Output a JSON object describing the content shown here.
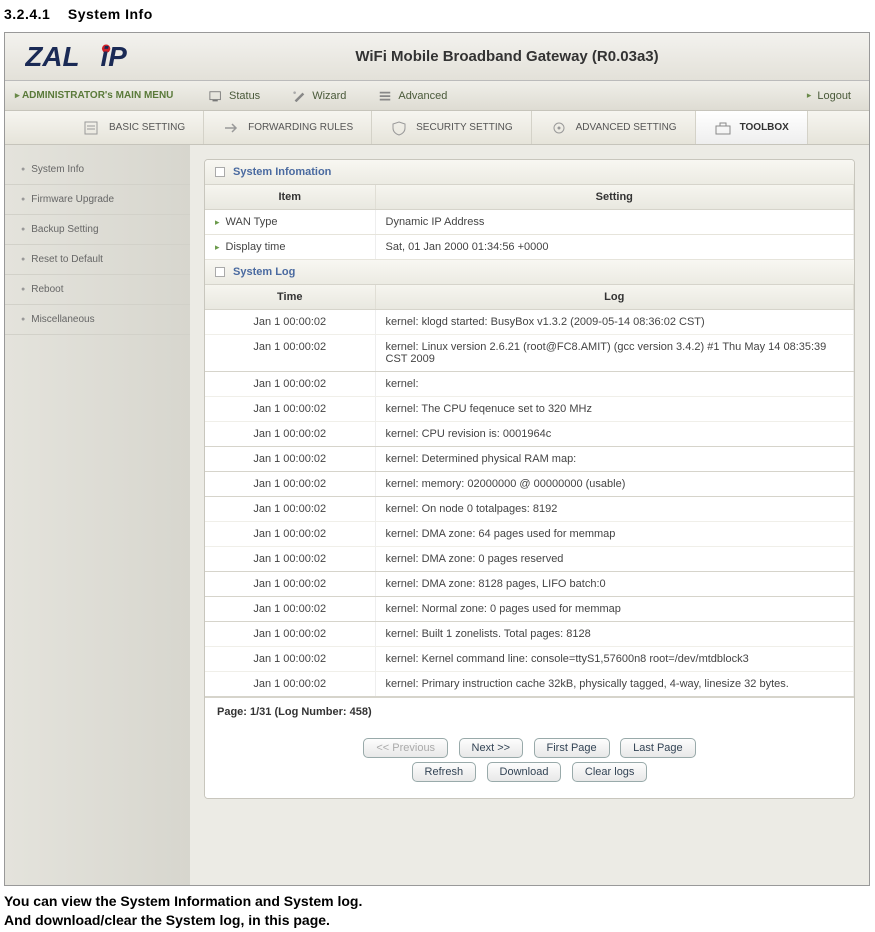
{
  "doc": {
    "section_number": "3.2.4.1",
    "section_title": "System Info",
    "footer_line1": "You can view the System Information and System log.",
    "footer_line2": "And download/clear the System log, in this page."
  },
  "header": {
    "product_title": "WiFi Mobile Broadband Gateway (R0.03a3)"
  },
  "topmenu": {
    "admin_label": "ADMINISTRATOR's MAIN MENU",
    "items": [
      {
        "label": "Status"
      },
      {
        "label": "Wizard"
      },
      {
        "label": "Advanced"
      }
    ],
    "logout": "Logout"
  },
  "submenu": {
    "items": [
      {
        "label": "BASIC  SETTING"
      },
      {
        "label": "FORWARDING RULES"
      },
      {
        "label": "SECURITY  SETTING"
      },
      {
        "label": "ADVANCED  SETTING"
      },
      {
        "label": "TOOLBOX"
      }
    ]
  },
  "sidebar": {
    "items": [
      {
        "label": "System Info"
      },
      {
        "label": "Firmware  Upgrade"
      },
      {
        "label": "Backup  Setting"
      },
      {
        "label": "Reset to Default"
      },
      {
        "label": "Reboot"
      },
      {
        "label": "Miscellaneous"
      }
    ]
  },
  "sys_info": {
    "title": "System Infomation",
    "col_item": "Item",
    "col_setting": "Setting",
    "rows": [
      {
        "item": "WAN Type",
        "value": "Dynamic IP Address"
      },
      {
        "item": "Display time",
        "value": "Sat, 01 Jan 2000 01:34:56 +0000"
      }
    ]
  },
  "sys_log": {
    "title": "System Log",
    "col_time": "Time",
    "col_log": "Log",
    "rows": [
      {
        "time": "Jan 1 00:00:02",
        "log": "kernel: klogd started: BusyBox v1.3.2 (2009-05-14 08:36:02 CST)"
      },
      {
        "time": "Jan 1 00:00:02",
        "log": "kernel: Linux version 2.6.21 (root@FC8.AMIT) (gcc version 3.4.2) #1 Thu May 14 08:35:39 CST 2009"
      },
      {
        "time": "Jan 1 00:00:02",
        "log": "kernel:"
      },
      {
        "time": "Jan 1 00:00:02",
        "log": "kernel: The CPU feqenuce set to 320 MHz"
      },
      {
        "time": "Jan 1 00:00:02",
        "log": "kernel: CPU revision is: 0001964c"
      },
      {
        "time": "Jan 1 00:00:02",
        "log": "kernel: Determined physical RAM map:"
      },
      {
        "time": "Jan 1 00:00:02",
        "log": "kernel: memory: 02000000 @ 00000000 (usable)"
      },
      {
        "time": "Jan 1 00:00:02",
        "log": "kernel: On node 0 totalpages: 8192"
      },
      {
        "time": "Jan 1 00:00:02",
        "log": "kernel: DMA zone: 64 pages used for memmap"
      },
      {
        "time": "Jan 1 00:00:02",
        "log": "kernel: DMA zone: 0 pages reserved"
      },
      {
        "time": "Jan 1 00:00:02",
        "log": "kernel: DMA zone: 8128 pages, LIFO batch:0"
      },
      {
        "time": "Jan 1 00:00:02",
        "log": "kernel: Normal zone: 0 pages used for memmap"
      },
      {
        "time": "Jan 1 00:00:02",
        "log": "kernel: Built 1 zonelists. Total pages: 8128"
      },
      {
        "time": "Jan 1 00:00:02",
        "log": "kernel: Kernel command line: console=ttyS1,57600n8 root=/dev/mtdblock3"
      },
      {
        "time": "Jan 1 00:00:02",
        "log": "kernel: Primary instruction cache 32kB, physically tagged, 4-way, linesize 32 bytes."
      }
    ],
    "pager": "Page: 1/31 (Log Number: 458)",
    "buttons": {
      "prev": "<< Previous",
      "next": "Next >>",
      "first": "First Page",
      "last": "Last Page",
      "refresh": "Refresh",
      "download": "Download",
      "clear": "Clear logs"
    }
  }
}
